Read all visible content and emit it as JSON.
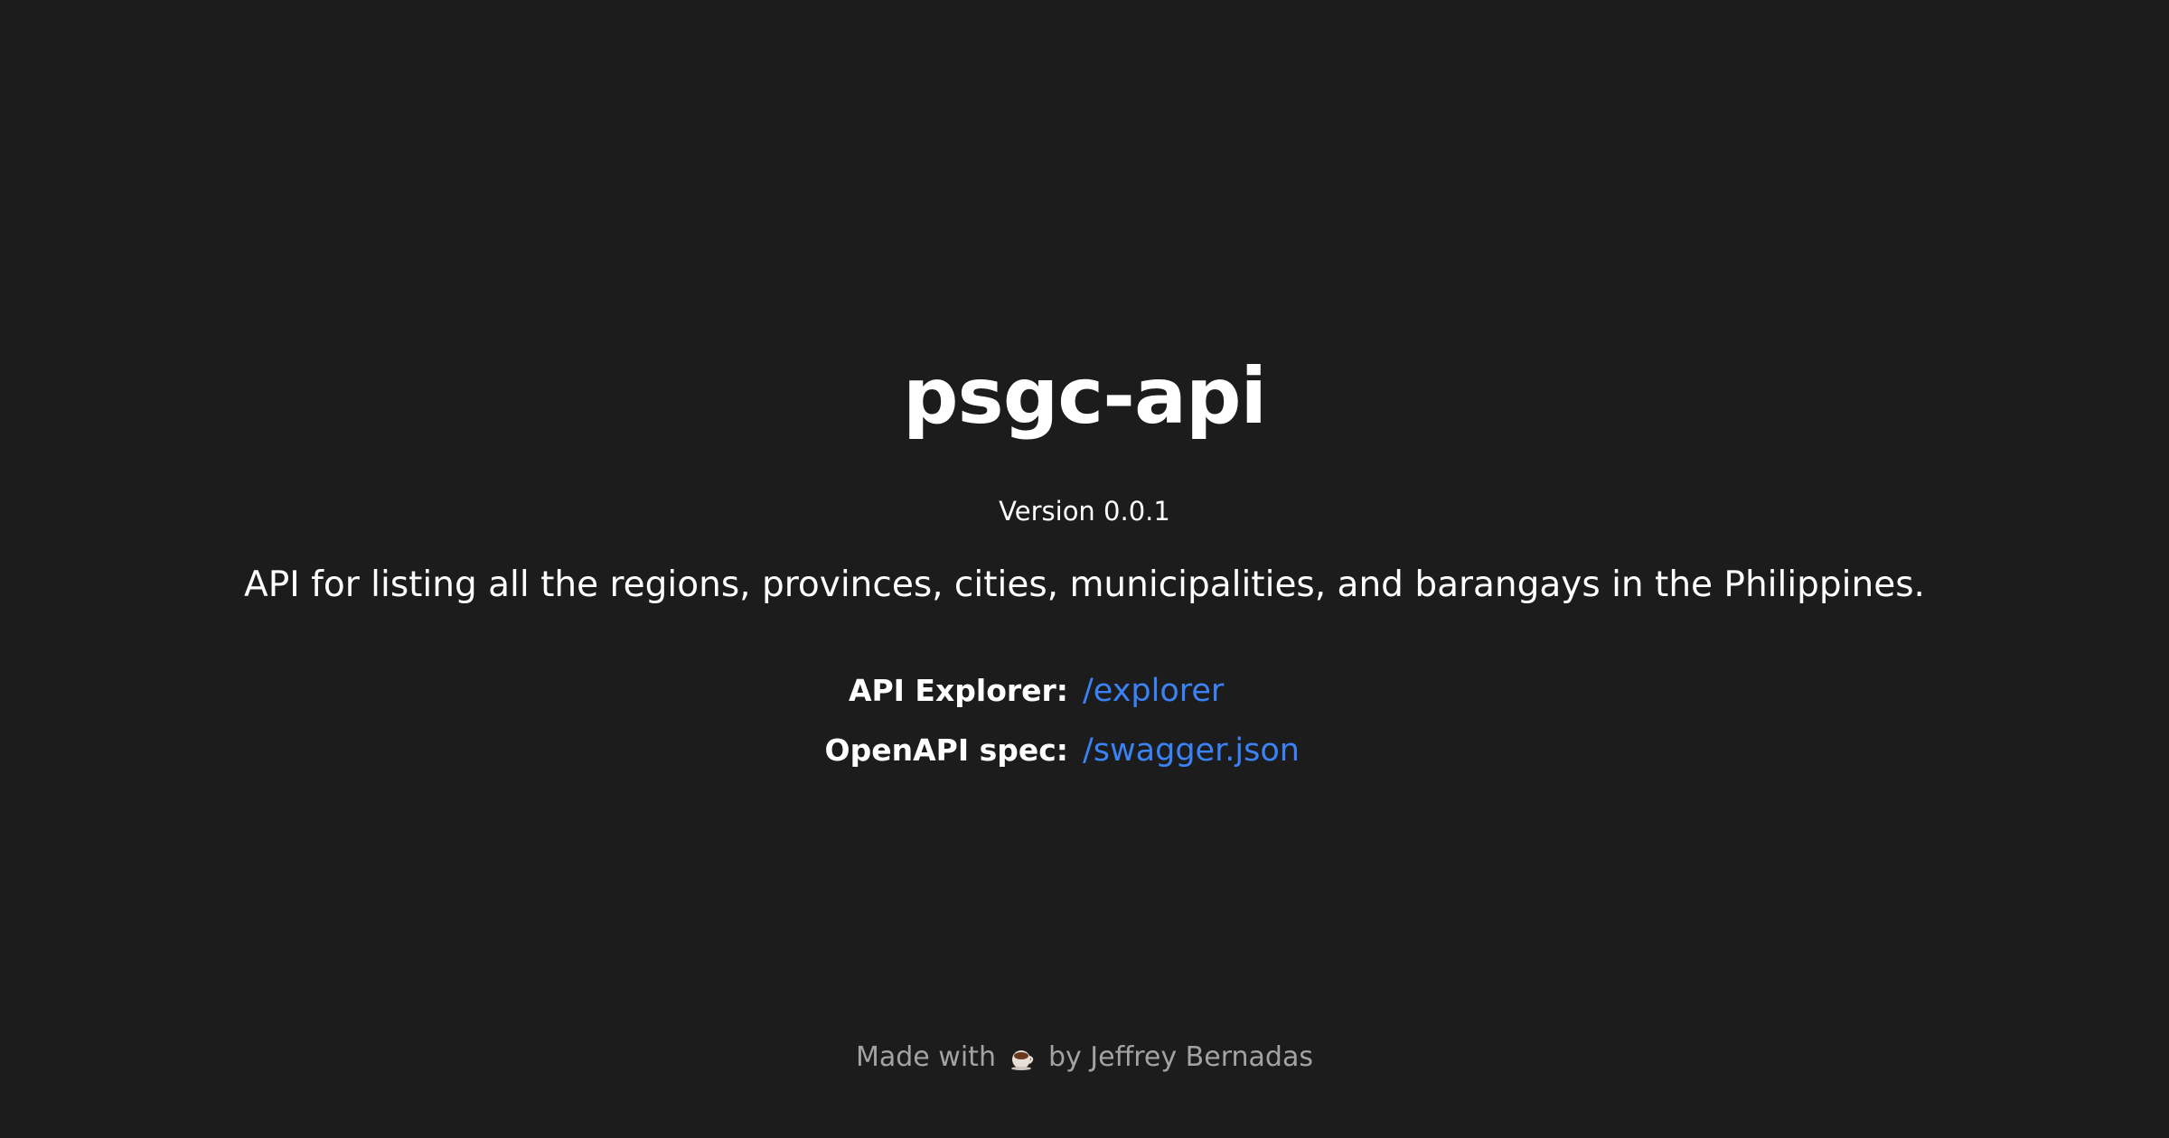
{
  "header": {
    "title": "psgc-api",
    "version": "Version 0.0.1"
  },
  "main": {
    "description": "API for listing all the regions, provinces, cities, municipalities, and barangays in the Philippines.",
    "links": [
      {
        "label": "API Explorer:",
        "value": "/explorer"
      },
      {
        "label": "OpenAPI spec:",
        "value": "/swagger.json"
      }
    ]
  },
  "footer": {
    "prefix": "Made with",
    "icon": "coffee-icon",
    "suffix": "by Jeffrey Bernadas"
  },
  "colors": {
    "background": "#1c1c1c",
    "text": "#ffffff",
    "link": "#3b82f6",
    "muted": "#a3a3a3"
  }
}
